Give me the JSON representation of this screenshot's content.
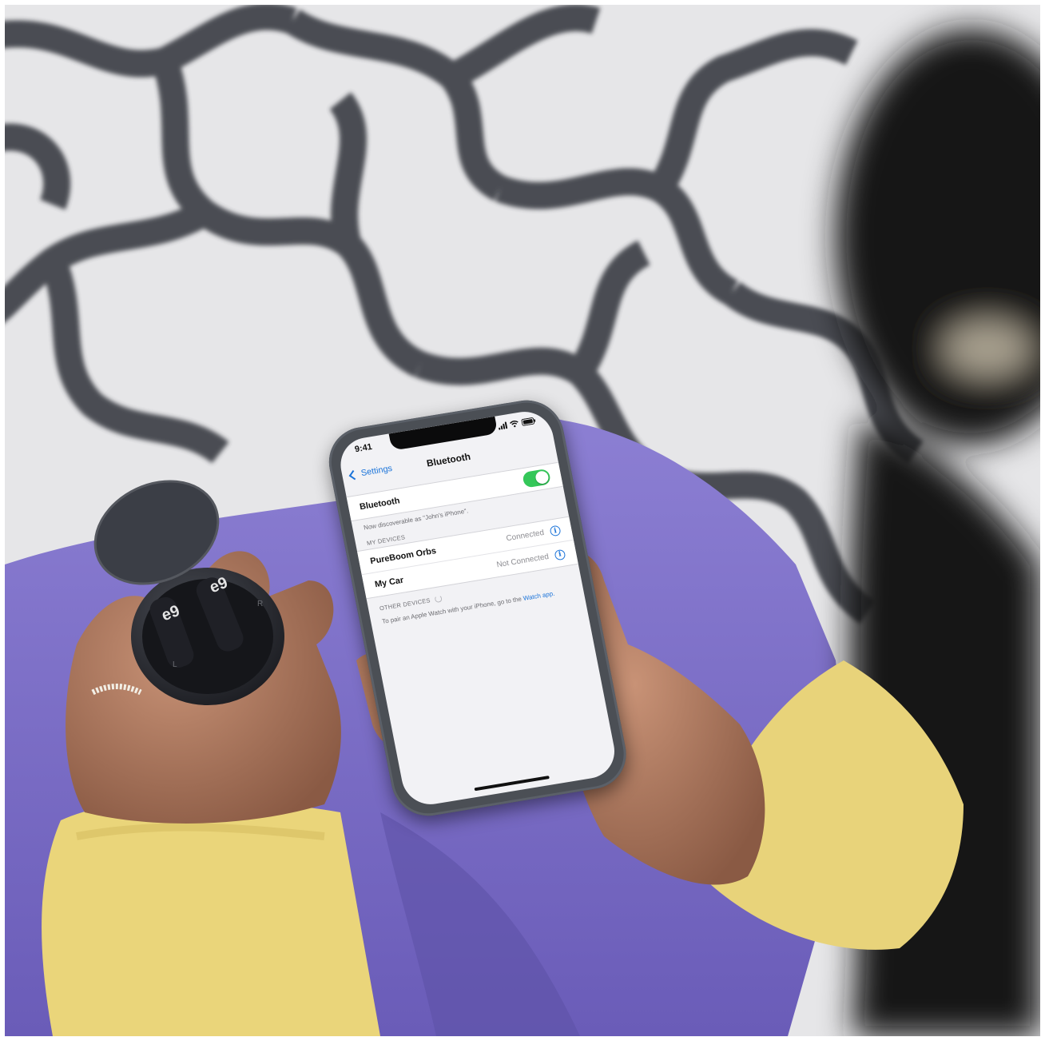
{
  "phone": {
    "status_time": "9:41",
    "nav": {
      "back_label": "Settings",
      "title": "Bluetooth"
    },
    "bluetooth_row": {
      "label": "Bluetooth",
      "enabled": true
    },
    "discoverable_note": "Now discoverable as \"John's iPhone\".",
    "my_devices": {
      "header": "MY DEVICES",
      "items": [
        {
          "name": "PureBoom Orbs",
          "status": "Connected"
        },
        {
          "name": "My Car",
          "status": "Not Connected"
        }
      ]
    },
    "other_devices": {
      "header": "OTHER DEVICES"
    },
    "pair_note": "To pair an Apple Watch with your iPhone, go to the",
    "pair_link": "Watch app."
  },
  "earbuds": {
    "logo_left": "e9",
    "logo_right": "e9",
    "marking_left": "L",
    "marking_right": "R"
  },
  "colors": {
    "toggle_on": "#34c759",
    "link_blue": "#1a73d9",
    "sleeve_yellow": "#ead57a",
    "pants_purple": "#7a6cc4",
    "rug_white": "#ececec",
    "rug_pattern": "#3d3f46",
    "phone_case": "#4b4f55"
  }
}
